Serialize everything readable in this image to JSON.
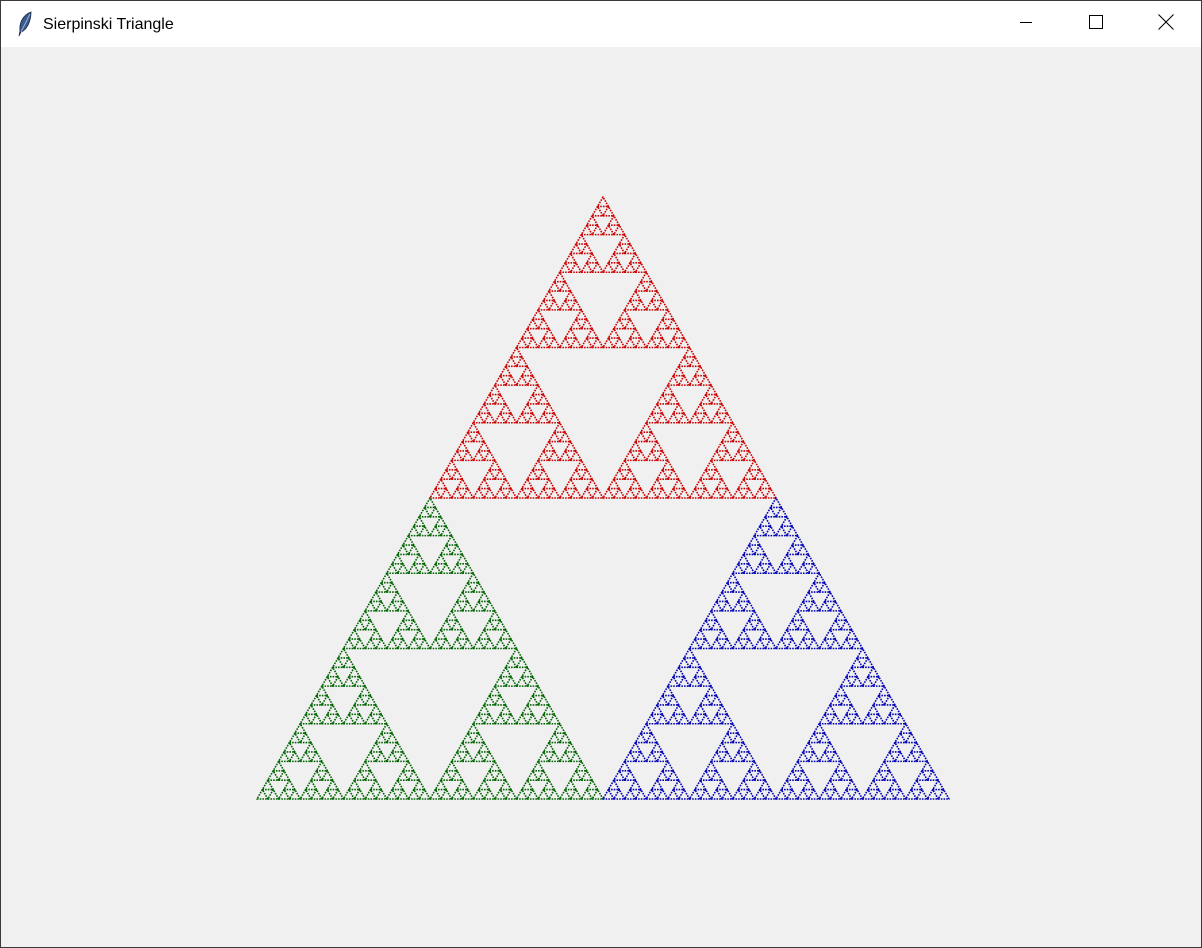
{
  "window": {
    "title": "Sierpinski Triangle",
    "app_icon": "feather-icon",
    "controls": {
      "minimize_icon": "minimize-icon",
      "maximize_icon": "maximize-icon",
      "close_icon": "close-icon"
    }
  },
  "canvas": {
    "background": "#f0f0f0",
    "fractal": {
      "type": "sierpinski-triangle",
      "regions": [
        {
          "name": "top",
          "color": "#cc0000"
        },
        {
          "name": "bottom-left",
          "color": "#006400"
        },
        {
          "name": "bottom-right",
          "color": "#0000b4"
        }
      ]
    }
  }
}
